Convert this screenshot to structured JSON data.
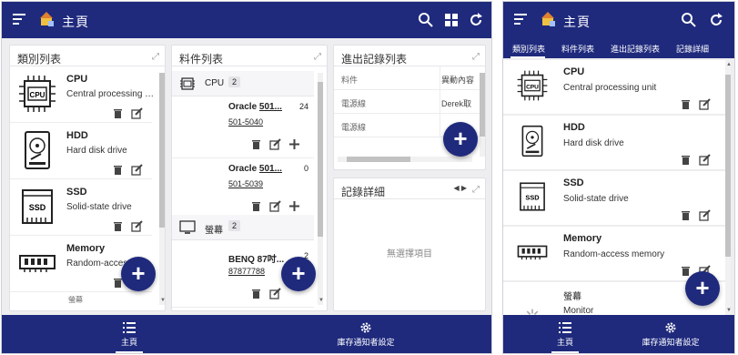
{
  "app": {
    "title": "主頁",
    "nav": {
      "home": "主頁",
      "settings": "庫存通知者設定"
    }
  },
  "wide": {
    "categories_panel": {
      "title": "類別列表",
      "items": [
        {
          "name": "CPU",
          "desc": "Central processing unit",
          "icon": "cpu-icon"
        },
        {
          "name": "HDD",
          "desc": "Hard disk drive",
          "icon": "hdd-icon"
        },
        {
          "name": "SSD",
          "desc": "Solid-state drive",
          "icon": "ssd-icon"
        },
        {
          "name": "Memory",
          "desc": "Random-access memory",
          "icon": "memory-icon"
        }
      ],
      "partial_label": "螢幕"
    },
    "materials_panel": {
      "title": "料件列表",
      "groups": [
        {
          "name": "CPU",
          "count": "2"
        },
        {
          "name": "螢幕",
          "count": "2"
        }
      ],
      "items": [
        {
          "name_prefix": "Oracle ",
          "name_link": "501...",
          "qty": "24",
          "code": "501-5040"
        },
        {
          "name_prefix": "Oracle ",
          "name_link": "501...",
          "qty": "0",
          "code": "501-5039"
        },
        {
          "name_prefix": "BENQ 87吋...",
          "name_link": "",
          "qty": "2",
          "code": "87877788"
        }
      ]
    },
    "records_panel": {
      "title": "進出記錄列表",
      "columns": [
        "料件",
        "異動內容"
      ],
      "rows": [
        [
          "電源線",
          "Derek取"
        ],
        [
          "電源線",
          ""
        ],
        [
          "",
          ""
        ]
      ]
    },
    "detail_panel": {
      "title": "記錄詳細",
      "empty_text": "無選擇項目"
    }
  },
  "narrow": {
    "tabs": [
      "類別列表",
      "料件列表",
      "進出記錄列表",
      "記錄詳細"
    ],
    "items": [
      {
        "name": "CPU",
        "desc": "Central processing unit",
        "icon": "cpu-icon"
      },
      {
        "name": "HDD",
        "desc": "Hard disk drive",
        "icon": "hdd-icon"
      },
      {
        "name": "SSD",
        "desc": "Solid-state drive",
        "icon": "ssd-icon"
      },
      {
        "name": "Memory",
        "desc": "Random-access memory",
        "icon": "memory-icon"
      },
      {
        "name": "螢幕",
        "desc": "Monitor",
        "icon": "monitor-icon"
      }
    ]
  },
  "colors": {
    "primary": "#1f2a7d",
    "background": "#eeeef0"
  }
}
